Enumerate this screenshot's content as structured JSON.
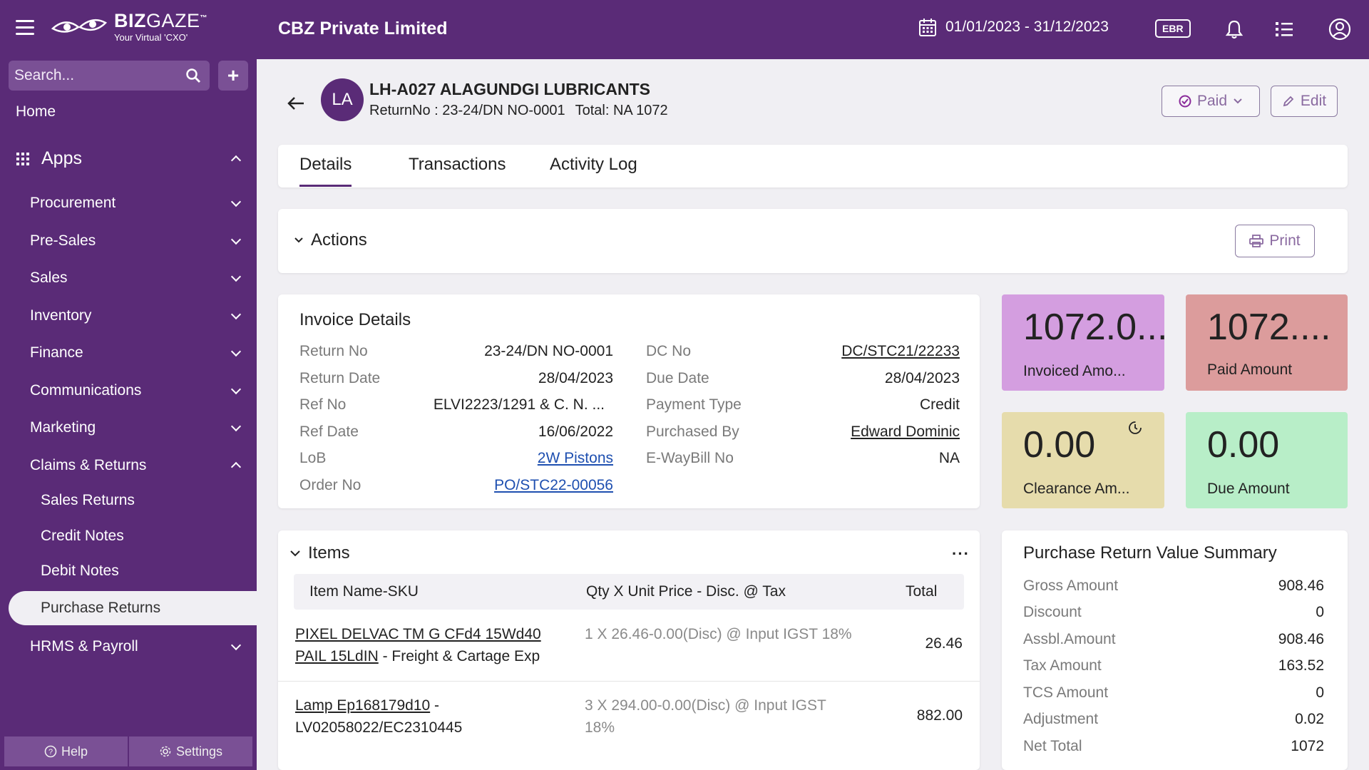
{
  "topbar": {
    "logo_name_bold": "BIZ",
    "logo_name_light": "GAZE",
    "logo_tm": "™",
    "logo_tagline": "Your Virtual 'CXO'",
    "company": "CBZ Private Limited",
    "date_range": "01/01/2023 - 31/12/2023",
    "ebr_label": "EBR"
  },
  "sidebar": {
    "search_placeholder": "Search...",
    "add_label": "+",
    "home": "Home",
    "apps": "Apps",
    "items": [
      {
        "label": "Procurement"
      },
      {
        "label": "Pre-Sales"
      },
      {
        "label": "Sales"
      },
      {
        "label": "Inventory"
      },
      {
        "label": "Finance"
      },
      {
        "label": "Communications"
      },
      {
        "label": "Marketing"
      },
      {
        "label": "Claims & Returns"
      }
    ],
    "sub_items": [
      {
        "label": "Sales Returns"
      },
      {
        "label": "Credit Notes"
      },
      {
        "label": "Debit Notes"
      },
      {
        "label": "Purchase Returns"
      }
    ],
    "hrms": "HRMS & Payroll",
    "help": "Help",
    "settings": "Settings"
  },
  "header": {
    "avatar": "LA",
    "title": "LH-A027 ALAGUNDGI LUBRICANTS",
    "return_no": "ReturnNo : 23-24/DN NO-0001",
    "total": "Total: NA 1072",
    "status_label": "Paid",
    "edit_label": "Edit"
  },
  "tabs": [
    {
      "label": "Details"
    },
    {
      "label": "Transactions"
    },
    {
      "label": "Activity Log"
    }
  ],
  "actions": {
    "title": "Actions",
    "print_label": "Print"
  },
  "invoice": {
    "title": "Invoice Details",
    "left": [
      {
        "label": "Return No",
        "value": "23-24/DN NO-0001"
      },
      {
        "label": "Return Date",
        "value": "28/04/2023"
      },
      {
        "label": "Ref No",
        "value": "ELVI2223/1291 & C. N. ..."
      },
      {
        "label": "Ref Date",
        "value": "16/06/2022"
      },
      {
        "label": "LoB",
        "value": "2W Pistons"
      },
      {
        "label": "Order No",
        "value": "PO/STC22-00056"
      }
    ],
    "right": [
      {
        "label": "DC No",
        "value": "DC/STC21/22233"
      },
      {
        "label": "Due Date",
        "value": "28/04/2023"
      },
      {
        "label": "Payment Type",
        "value": "Credit"
      },
      {
        "label": "Purchased By",
        "value": "Edward Dominic"
      },
      {
        "label": "E-WayBill No",
        "value": "NA"
      }
    ]
  },
  "stats": {
    "invoiced": {
      "value": "1072.0...",
      "label": "Invoiced Amo...",
      "color": "#d49ee0"
    },
    "paid": {
      "value": "1072....",
      "label": "Paid Amount",
      "color": "#dc9c9c"
    },
    "clearance": {
      "value": "0.00",
      "label": "Clearance Am...",
      "color": "#e6dcac"
    },
    "due": {
      "value": "0.00",
      "label": "Due Amount",
      "color": "#b8eec8"
    }
  },
  "items": {
    "title": "Items",
    "more": "···",
    "headers": {
      "name": "Item Name-SKU",
      "calc": "Qty X Unit Price - Disc. @ Tax",
      "total": "Total"
    },
    "rows": [
      {
        "name_link": "PIXEL DELVAC TM G CFd4 15Wd40 PAIL 15LdIN",
        "name_rest": " - Freight & Cartage Exp",
        "calc": "1 X 26.46-0.00(Disc) @ Input IGST 18%",
        "total": "26.46"
      },
      {
        "name_link": "Lamp Ep168179d10",
        "name_rest": " - LV02058022/EC2310445",
        "calc": "3 X 294.00-0.00(Disc) @ Input IGST 18%",
        "total": "882.00"
      }
    ]
  },
  "summary": {
    "title": "Purchase Return Value Summary",
    "rows": [
      {
        "label": "Gross Amount",
        "value": "908.46"
      },
      {
        "label": "Discount",
        "value": "0"
      },
      {
        "label": "Assbl.Amount",
        "value": "908.46"
      },
      {
        "label": "Tax Amount",
        "value": "163.52"
      },
      {
        "label": "TCS Amount",
        "value": "0"
      },
      {
        "label": "Adjustment",
        "value": "0.02"
      },
      {
        "label": "Net Total",
        "value": "1072"
      }
    ]
  }
}
